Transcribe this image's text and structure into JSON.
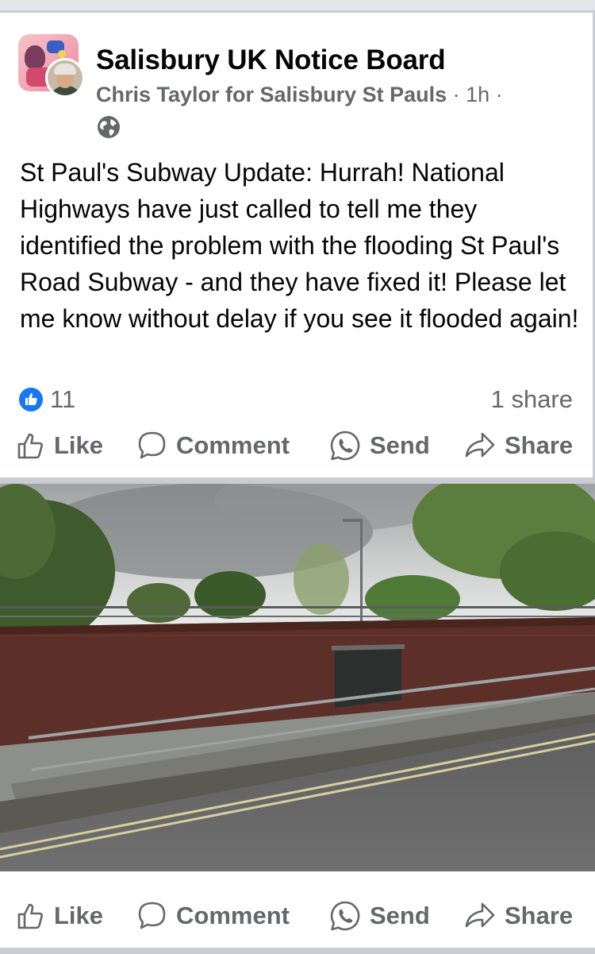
{
  "post": {
    "group_name": "Salisbury UK Notice Board",
    "author": "Chris Taylor for Salisbury St Pauls",
    "time": "· 1h ·",
    "privacy_icon": "globe-icon",
    "text": "St Paul's Subway Update: Hurrah! National Highways have just called to tell me they identified the problem with the flooding St Paul's Road Subway - and they have fixed it! Please let me know without delay if you see it flooded again!",
    "reaction_icon": "thumbs-up-icon",
    "like_count": "11",
    "share_count": "1 share"
  },
  "actions": {
    "like": "Like",
    "comment": "Comment",
    "send": "Send",
    "share": "Share"
  },
  "photo_actions": {
    "like": "Like",
    "comment": "Comment",
    "send": "Send",
    "share": "Share"
  },
  "colors": {
    "accent": "#1877f2",
    "secondary_text": "#65676b",
    "separator": "#c9ccd1"
  }
}
